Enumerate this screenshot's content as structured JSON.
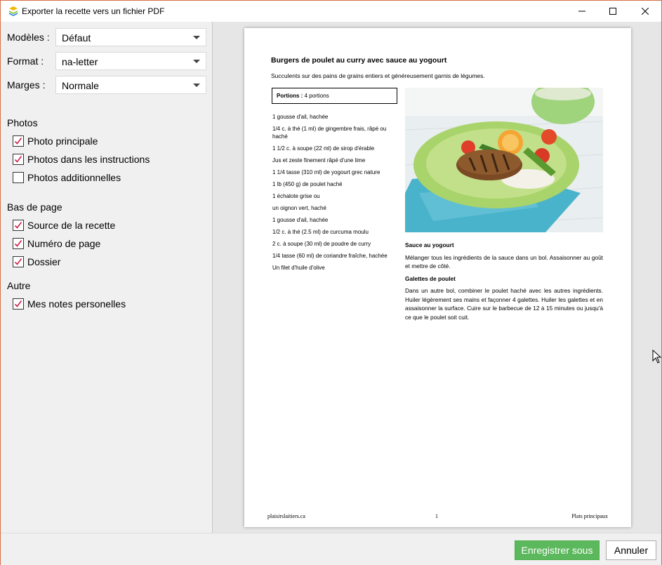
{
  "window": {
    "title": "Exporter la recette vers un fichier PDF"
  },
  "settings": {
    "template_label": "Modèles :",
    "template_value": "Défaut",
    "format_label": "Format :",
    "format_value": "na-letter",
    "margins_label": "Marges :",
    "margins_value": "Normale"
  },
  "sections": {
    "photos": {
      "title": "Photos",
      "items": [
        {
          "label": "Photo principale",
          "checked": true
        },
        {
          "label": "Photos dans les instructions",
          "checked": true
        },
        {
          "label": "Photos additionnelles",
          "checked": false
        }
      ]
    },
    "footer": {
      "title": "Bas de page",
      "items": [
        {
          "label": "Source de la recette",
          "checked": true
        },
        {
          "label": "Numéro de page",
          "checked": true
        },
        {
          "label": "Dossier",
          "checked": true
        }
      ]
    },
    "other": {
      "title": "Autre",
      "items": [
        {
          "label": "Mes notes personelles",
          "checked": true
        }
      ]
    }
  },
  "recipe": {
    "title": "Burgers de poulet au curry avec sauce au yogourt",
    "subtitle": "Succulents sur des pains de grains entiers et généreusement garnis de légumes.",
    "portions_label": "Portions :",
    "portions_value": "4 portions",
    "ingredients": [
      "1 gousse d'ail, hachée",
      "1/4 c. à thé (1 ml) de gingembre frais, râpé ou haché",
      "1 1/2 c. à soupe (22 ml) de sirop d'érable",
      "Jus et zeste finement râpé d'une lime",
      "1 1/4 tasse (310 ml) de yogourt grec nature",
      "1 lb (450 g) de poulet haché",
      "1 échalote grise ou",
      "un oignon vert, haché",
      "1 gousse d'ail, hachée",
      "1/2 c. à thé (2.5 ml) de curcuma moulu",
      "2 c. à soupe (30 ml) de poudre de curry",
      "1/4 tasse (60 ml) de coriandre fraîche, hachée",
      "Un filet d'huile d'olive"
    ],
    "steps": [
      {
        "heading": "Sauce au yogourt",
        "text": "Mélanger tous les ingrédients de la sauce dans un bol. Assaisonner au goût et mettre de côté."
      },
      {
        "heading": "Galettes de poulet",
        "text": "Dans un autre bol, combiner le poulet haché avec les autres ingrédients. Huiler légèrement ses mains et façonner 4 galettes. Huiler les galettes et en assaisonner la surface. Cuire sur le barbecue de 12 à 15 minutes ou jusqu'à ce que le poulet soit cuit."
      }
    ],
    "footer_source": "plaisirslaitiers.ca",
    "footer_page": "1",
    "footer_folder": "Plats principaux"
  },
  "buttons": {
    "save": "Enregistrer sous",
    "cancel": "Annuler"
  },
  "colors": {
    "save_button": "#5cb85c",
    "checkmark": "#cc1f4a",
    "window_border": "#d8704a"
  }
}
